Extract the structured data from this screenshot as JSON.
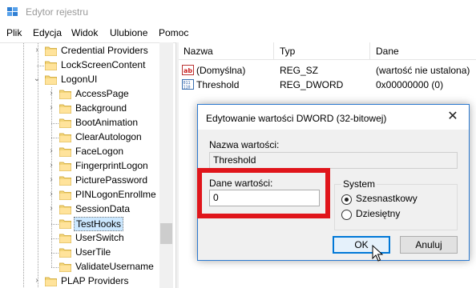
{
  "window": {
    "title": "Edytor rejestru"
  },
  "menu": [
    "Plik",
    "Edycja",
    "Widok",
    "Ulubione",
    "Pomoc"
  ],
  "tree": {
    "items": [
      {
        "label": "Credential Providers",
        "level": 1,
        "expandable": true,
        "expanded": false,
        "selected": false
      },
      {
        "label": "LockScreenContent",
        "level": 1,
        "expandable": false,
        "expanded": false,
        "selected": false
      },
      {
        "label": "LogonUI",
        "level": 1,
        "expandable": true,
        "expanded": true,
        "selected": false
      },
      {
        "label": "AccessPage",
        "level": 2,
        "expandable": true,
        "expanded": false,
        "selected": false
      },
      {
        "label": "Background",
        "level": 2,
        "expandable": true,
        "expanded": false,
        "selected": false
      },
      {
        "label": "BootAnimation",
        "level": 2,
        "expandable": false,
        "expanded": false,
        "selected": false
      },
      {
        "label": "ClearAutologon",
        "level": 2,
        "expandable": false,
        "expanded": false,
        "selected": false
      },
      {
        "label": "FaceLogon",
        "level": 2,
        "expandable": true,
        "expanded": false,
        "selected": false
      },
      {
        "label": "FingerprintLogon",
        "level": 2,
        "expandable": true,
        "expanded": false,
        "selected": false
      },
      {
        "label": "PicturePassword",
        "level": 2,
        "expandable": true,
        "expanded": false,
        "selected": false
      },
      {
        "label": "PINLogonEnrollme",
        "level": 2,
        "expandable": true,
        "expanded": false,
        "selected": false
      },
      {
        "label": "SessionData",
        "level": 2,
        "expandable": true,
        "expanded": false,
        "selected": false
      },
      {
        "label": "TestHooks",
        "level": 2,
        "expandable": false,
        "expanded": false,
        "selected": true
      },
      {
        "label": "UserSwitch",
        "level": 2,
        "expandable": false,
        "expanded": false,
        "selected": false
      },
      {
        "label": "UserTile",
        "level": 2,
        "expandable": false,
        "expanded": false,
        "selected": false
      },
      {
        "label": "ValidateUsername",
        "level": 2,
        "expandable": false,
        "expanded": false,
        "selected": false
      },
      {
        "label": "PLAP Providers",
        "level": 1,
        "expandable": true,
        "expanded": false,
        "selected": false
      }
    ]
  },
  "list": {
    "columns": [
      "Nazwa",
      "Typ",
      "Dane"
    ],
    "rows": [
      {
        "icon": "string-value-icon",
        "name": "(Domyślna)",
        "type": "REG_SZ",
        "data": "(wartość nie ustalona)"
      },
      {
        "icon": "dword-value-icon",
        "name": "Threshold",
        "type": "REG_DWORD",
        "data": "0x00000000 (0)"
      }
    ]
  },
  "dialog": {
    "title": "Edytowanie wartości DWORD (32-bitowej)",
    "close": "✕",
    "name_label": "Nazwa wartości:",
    "name_value": "Threshold",
    "data_label": "Dane wartości:",
    "data_value": "0",
    "system_label": "System",
    "radio_hex": "Szesnastkowy",
    "radio_dec": "Dziesiętny",
    "selected_base": "hex",
    "ok": "OK",
    "cancel": "Anuluj"
  },
  "colors": {
    "highlight": "#e0151b",
    "selection": "#cce8ff",
    "accent": "#0078d7"
  }
}
